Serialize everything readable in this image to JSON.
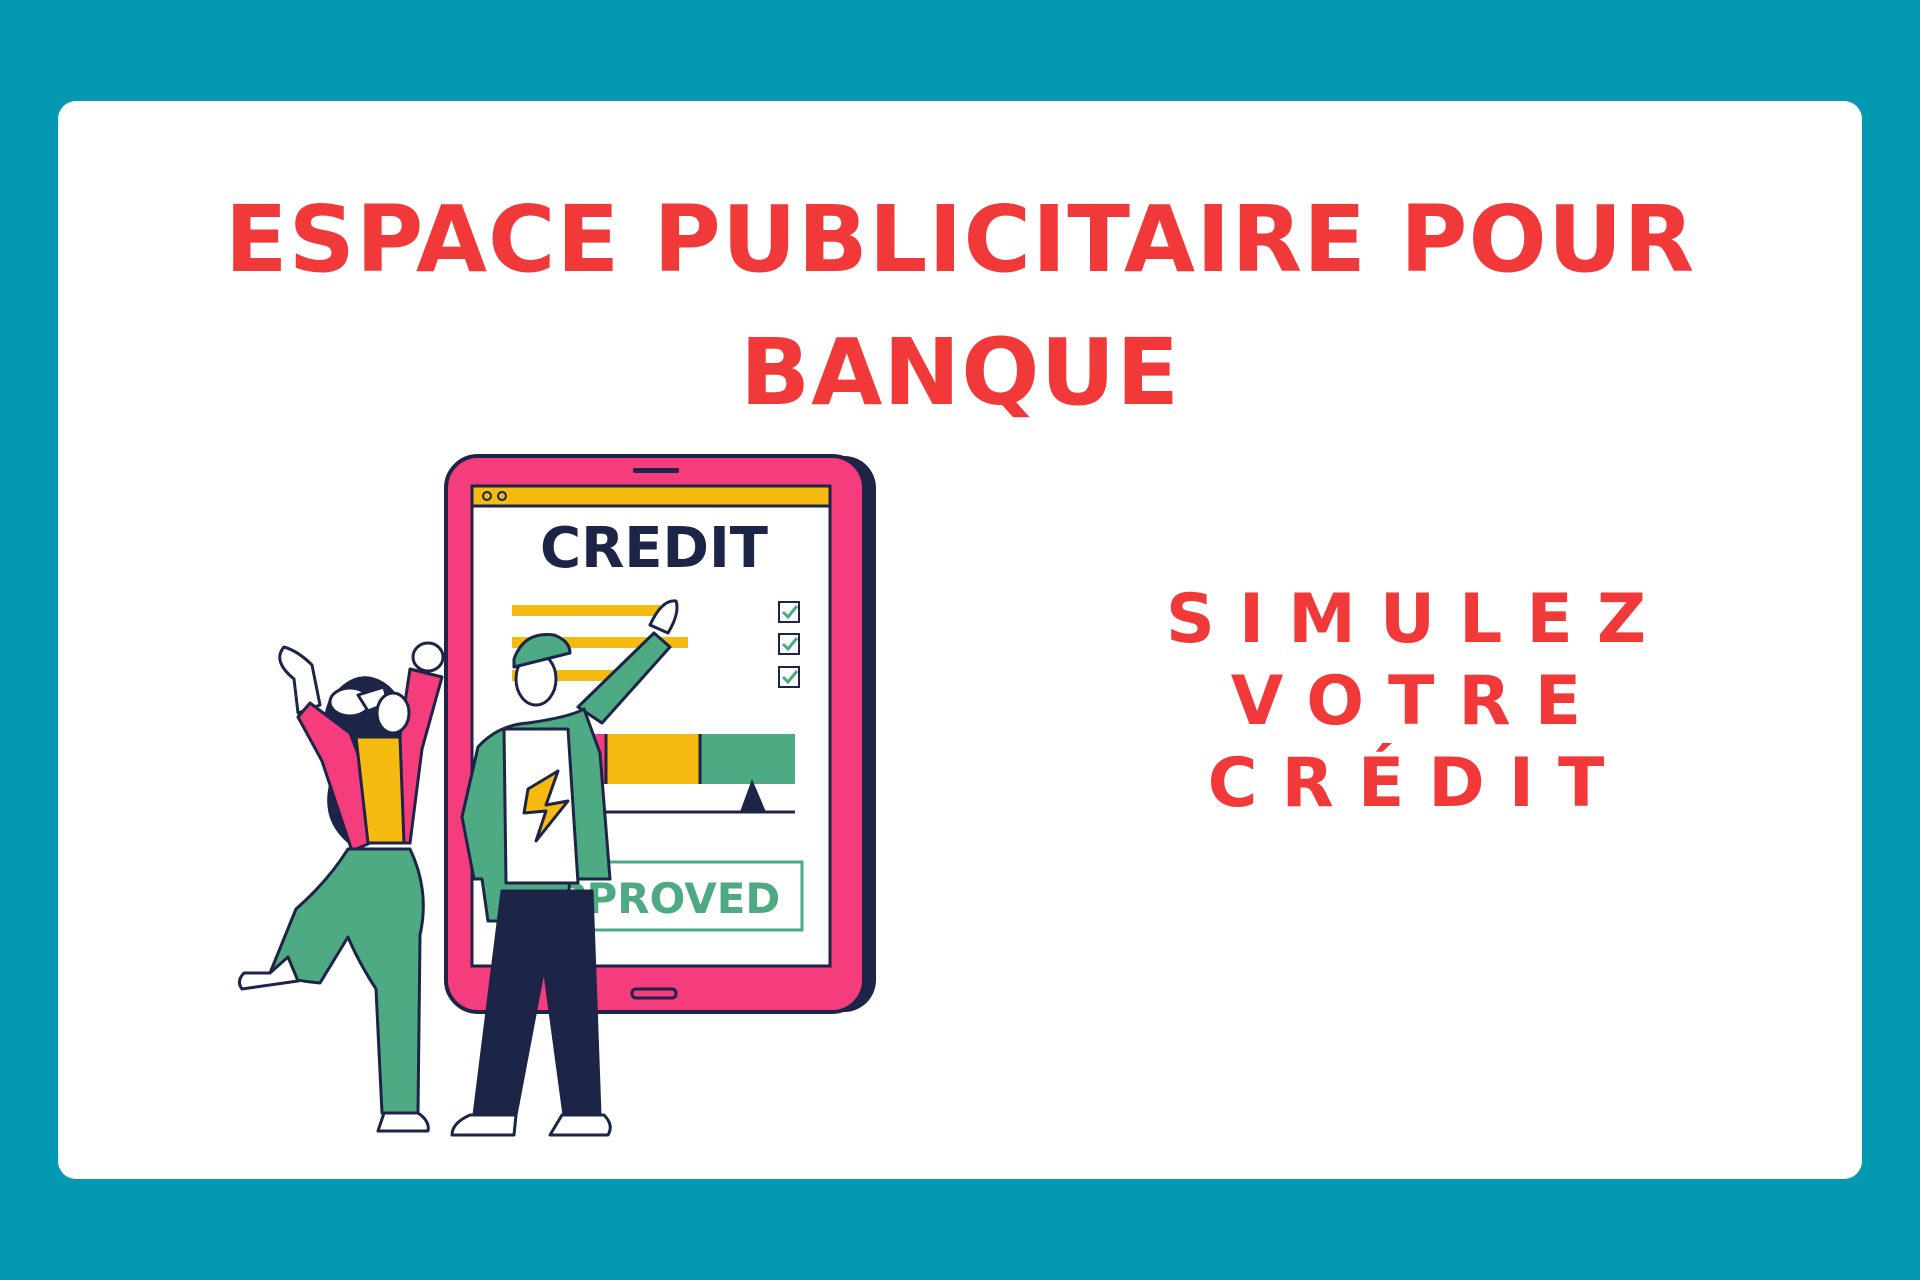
{
  "headline": {
    "line1": "ESPACE PUBLICITAIRE POUR",
    "line2": "BANQUE"
  },
  "cta": {
    "line1": "SIMULEZ",
    "line2": "VOTRE",
    "line3": "CRÉDIT"
  },
  "illustration": {
    "screen_title": "CREDIT",
    "stamp": "PPROVED",
    "checklist_checked": [
      true,
      true,
      true
    ],
    "gauge_segments": [
      "pink",
      "yellow",
      "green"
    ]
  },
  "colors": {
    "background": "#0399b3",
    "card": "#ffffff",
    "accent_red": "#f2393a",
    "tablet_pink": "#f53d7e",
    "tablet_shadow": "#1c2447",
    "bar_yellow": "#f6bb10",
    "green": "#4eaa82",
    "navy": "#1c2447"
  }
}
